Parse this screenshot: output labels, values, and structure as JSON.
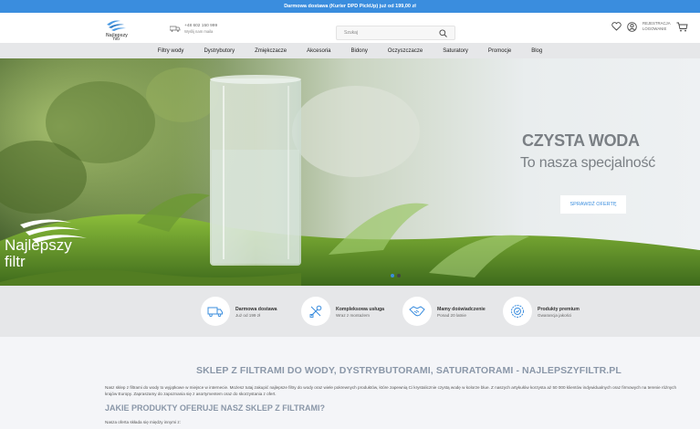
{
  "topbar": {
    "text": "Darmowa dostawa (Kurier DPD PickUp) już od 199,00 zł"
  },
  "header": {
    "logo_text": "Najlepszy filtr",
    "phone": "+48 602 150 999",
    "phone_note": "Wyślij nam maila",
    "search_placeholder": "Szukaj",
    "account_line1": "REJESTRACJA",
    "account_line2": "LOGOWANIE"
  },
  "nav": {
    "items": [
      "Filtry wody",
      "Dystrybutory",
      "Zmiękczacze",
      "Akcesoria",
      "Bidony",
      "Oczyszczacze",
      "Saturatory",
      "Promocje",
      "Blog"
    ]
  },
  "hero": {
    "headline": "CZYSTA WODA",
    "subline": "To nasza specjalność",
    "cta": "SPRAWDŹ OFERTĘ",
    "brand_line1": "Najlepszy",
    "brand_line2": "filtr",
    "slide_count": 2,
    "active_slide": 1
  },
  "features": [
    {
      "title": "Darmowa dostawa",
      "subtitle": "Już od 199 zł",
      "icon": "truck-icon"
    },
    {
      "title": "Kompleksowa usługa",
      "subtitle": "Wraz z montażem",
      "icon": "tools-icon"
    },
    {
      "title": "Mamy doświadczenie",
      "subtitle": "Ponad 20 latnie",
      "icon": "handshake-icon"
    },
    {
      "title": "Produkty premium",
      "subtitle": "Gwarancja jakości",
      "icon": "badge-icon"
    }
  ],
  "content": {
    "heading": "SKLEP Z FILTRAMI DO WODY, DYSTRYBUTORAMI, SATURATORAMI - NAJLEPSZYFILTR.PL",
    "paragraph": "Nasz sklep z filtrami do wody to wyjątkowe w miejsce w internecie. Możesz tutaj zakupić najlepsze filtry do wody oraz wiele pokrewnych produktów, które zapewnią Ci krystalicznie czystą wodę w kolorze blue. Z naszych artykułów korzysta aż 50 000 klientów indywidualnych oraz firmowych na terenie różnych krajów Europy. Zapraszamy do zapoznania się z asortymentem oraz do skorzystania z ofert.",
    "subheading": "JAKIE PRODUKTY OFERUJE NASZ SKLEP Z FILTRAMI?",
    "list_intro": "Nasza oferta składa się między innymi z:"
  },
  "colors": {
    "accent": "#3a8dde",
    "nav_bg": "#e6e7e9",
    "heading": "#8a97a8"
  }
}
